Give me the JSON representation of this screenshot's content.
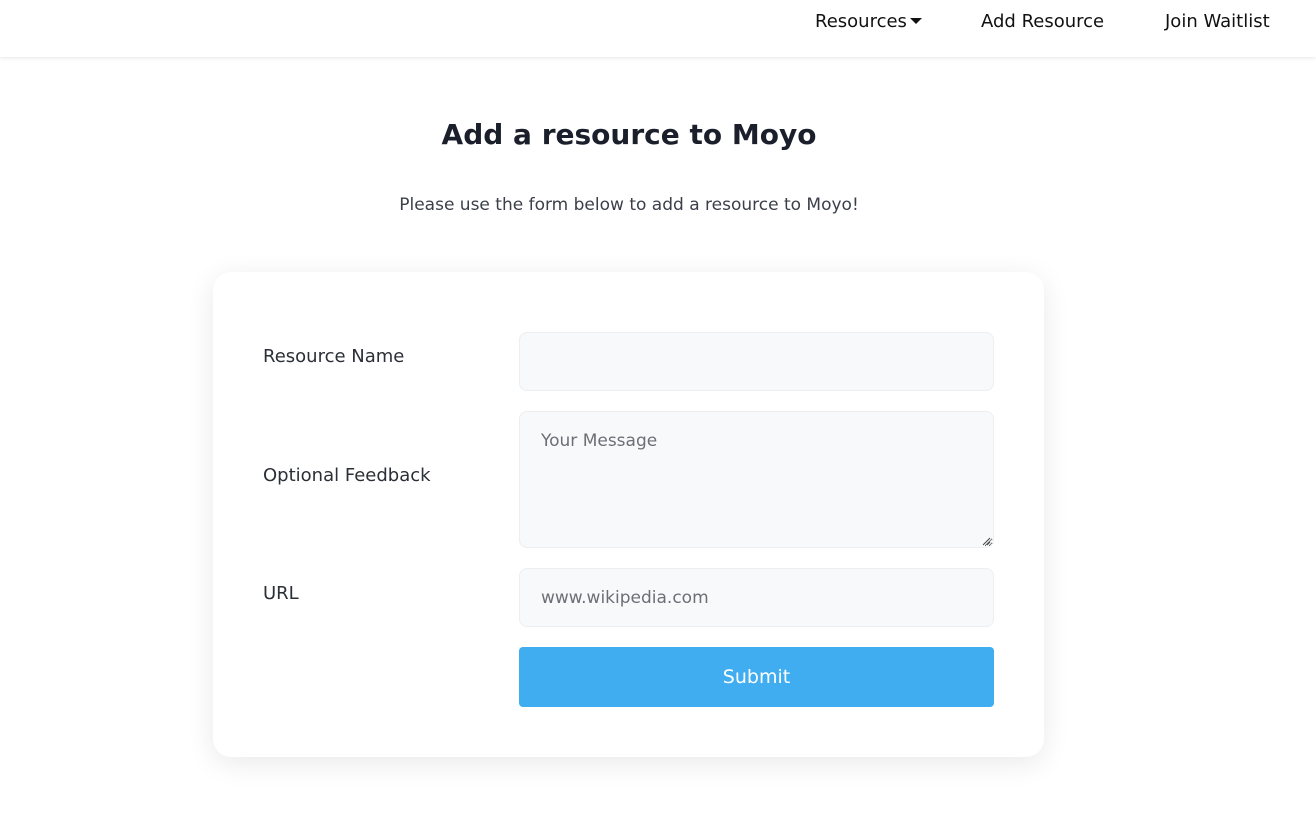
{
  "nav": {
    "resources_label": "Resources",
    "add_resource_label": "Add Resource",
    "join_waitlist_label": "Join Waitlist"
  },
  "main": {
    "title": "Add a resource to Moyo",
    "subtitle": "Please use the form below to add a resource to Moyo!"
  },
  "form": {
    "resource_name": {
      "label": "Resource Name",
      "value": "",
      "placeholder": ""
    },
    "feedback": {
      "label": "Optional Feedback",
      "value": "",
      "placeholder": "Your Message"
    },
    "url": {
      "label": "URL",
      "value": "",
      "placeholder": "www.wikipedia.com"
    },
    "submit_label": "Submit"
  },
  "icons": {
    "resources_dropdown": "caret-down-icon",
    "textarea_resize": "resize-grip-icon"
  },
  "colors": {
    "accent": "#40adf0",
    "input_background": "#f8f9fa",
    "title_text": "#1a1f2b"
  }
}
